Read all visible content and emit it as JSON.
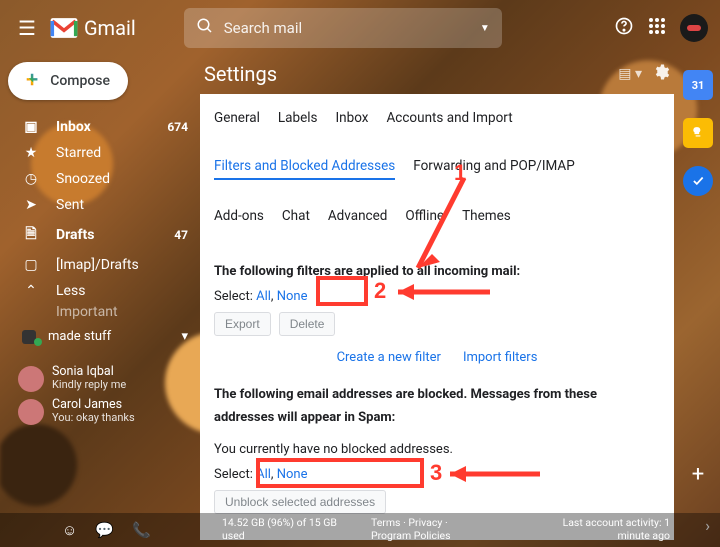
{
  "header": {
    "product": "Gmail",
    "search_placeholder": "Search mail"
  },
  "compose_label": "Compose",
  "nav": [
    {
      "icon": "inbox",
      "label": "Inbox",
      "count": "674",
      "selected": true
    },
    {
      "icon": "star",
      "label": "Starred"
    },
    {
      "icon": "clock",
      "label": "Snoozed"
    },
    {
      "icon": "send",
      "label": "Sent"
    },
    {
      "icon": "file",
      "label": "Drafts",
      "count": "47",
      "selected": true
    },
    {
      "icon": "folder",
      "label": "[Imap]/Drafts"
    },
    {
      "icon": "chev",
      "label": "Less"
    }
  ],
  "extra_label": "Important",
  "user_label": "made stuff",
  "chats": [
    {
      "name": "Sonia Iqbal",
      "msg": "Kindly reply me"
    },
    {
      "name": "Carol James",
      "msg": "You: okay thanks"
    }
  ],
  "settings_title": "Settings",
  "cal_day": "31",
  "tabs": {
    "row1": [
      "General",
      "Labels",
      "Inbox",
      "Accounts and Import"
    ],
    "row2": [
      "Filters and Blocked Addresses",
      "Forwarding and POP/IMAP"
    ],
    "row3": [
      "Add-ons",
      "Chat",
      "Advanced",
      "Offline",
      "Themes"
    ],
    "active": "Filters and Blocked Addresses"
  },
  "filters": {
    "heading": "The following filters are applied to all incoming mail:",
    "select_label": "Select:",
    "all": "All",
    "none": "None",
    "export": "Export",
    "delete": "Delete",
    "create": "Create a new filter",
    "import": "Import filters"
  },
  "blocked": {
    "heading": "The following email addresses are blocked. Messages from these addresses will appear in Spam:",
    "empty": "You currently have no blocked addresses.",
    "unblock": "Unblock selected addresses"
  },
  "footer": {
    "storage1": "14.52 GB (96%) of 15 GB",
    "storage2": "used",
    "mid1": "Terms · Privacy ·",
    "mid2": "Program Policies",
    "act1": "Last account activity: 1",
    "act2": "minute ago"
  },
  "annotations": {
    "n1": "1",
    "n2": "2",
    "n3": "3"
  }
}
